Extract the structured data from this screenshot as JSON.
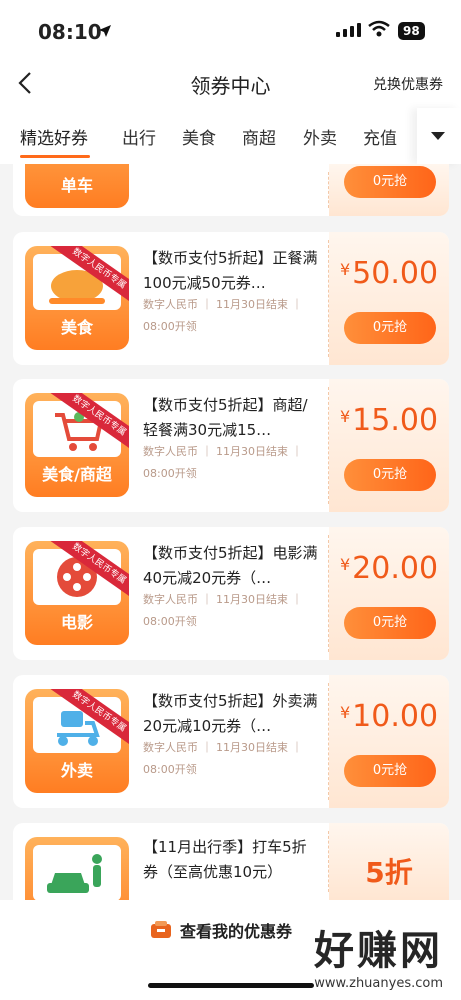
{
  "status_bar": {
    "time": "08:10",
    "battery": "98"
  },
  "nav": {
    "title": "领券中心",
    "exchange": "兑换优惠券"
  },
  "tabs": [
    "精选好券",
    "出行",
    "美食",
    "商超",
    "外卖",
    "充值"
  ],
  "cards": {
    "top": {
      "icon_label": "单车",
      "button": "0元抢"
    },
    "c1": {
      "icon_label": "美食",
      "ribbon": "数字人民币专属",
      "desc": "【数币支付5折起】正餐满100元减50元券…",
      "meta1": "数字人民币 ｜ 11月30日结束 ｜",
      "meta2": "08:00开领",
      "yen": "¥",
      "price": "50.00",
      "button": "0元抢"
    },
    "c2": {
      "icon_label": "美食/商超",
      "ribbon": "数字人民币专属",
      "desc": "【数币支付5折起】商超/轻餐满30元减15…",
      "meta1": "数字人民币 ｜ 11月30日结束 ｜",
      "meta2": "08:00开领",
      "yen": "¥",
      "price": "15.00",
      "button": "0元抢"
    },
    "c3": {
      "icon_label": "电影",
      "ribbon": "数字人民币专属",
      "desc": "【数币支付5折起】电影满40元减20元券（…",
      "meta1": "数字人民币 ｜ 11月30日结束 ｜",
      "meta2": "08:00开领",
      "yen": "¥",
      "price": "20.00",
      "button": "0元抢"
    },
    "c4": {
      "icon_label": "外卖",
      "ribbon": "数字人民币专属",
      "desc": "【数币支付5折起】外卖满20元减10元券（…",
      "meta1": "数字人民币 ｜ 11月30日结束 ｜",
      "meta2": "08:00开领",
      "yen": "¥",
      "price": "10.00",
      "button": "0元抢"
    },
    "c5": {
      "desc": "【11月出行季】打车5折券（至高优惠10元）",
      "price": "5折"
    }
  },
  "bottom": {
    "my_coupons": "查看我的优惠券"
  },
  "watermark": {
    "brand": "好赚网",
    "url": "www.zhuanyes.com"
  }
}
